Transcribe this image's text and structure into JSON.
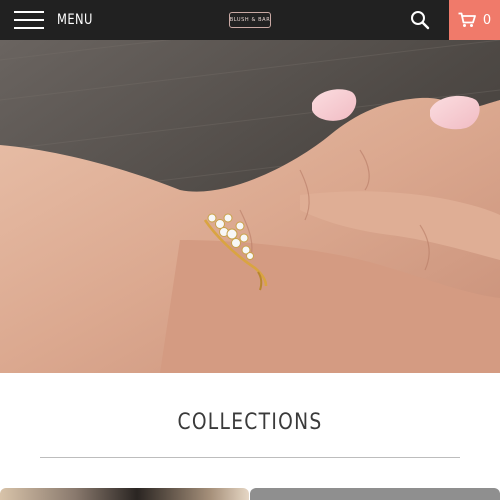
{
  "header": {
    "menu_label": "MENU",
    "logo_text": "BLUSH & BAR",
    "cart_count": "0",
    "colors": {
      "bar": "#212121",
      "cart_accent": "#f07a6a"
    }
  },
  "hero": {
    "image": "hand-wearing-gold-diamond-cluster-ring"
  },
  "collections": {
    "title": "COLLECTIONS",
    "tiles": [
      {
        "image": "collection-photo-1"
      },
      {
        "image": "collection-photo-2"
      }
    ]
  }
}
